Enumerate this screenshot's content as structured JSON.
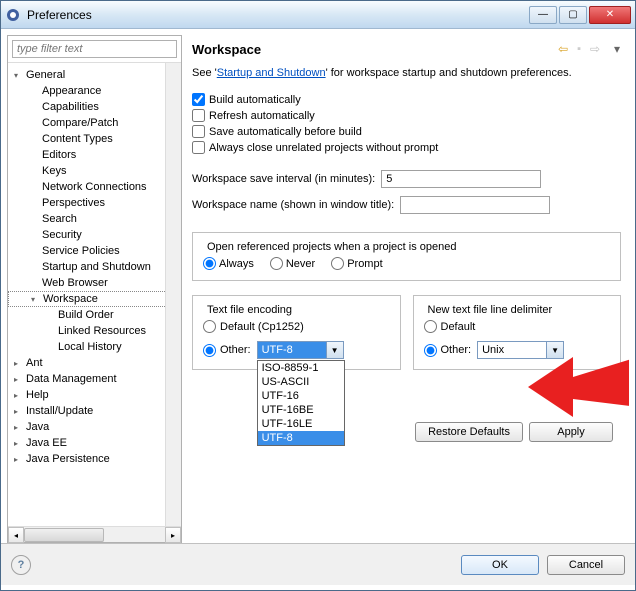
{
  "window": {
    "title": "Preferences"
  },
  "sidebar": {
    "filter_placeholder": "type filter text",
    "items": [
      {
        "label": "General",
        "level": 0,
        "expanded": true
      },
      {
        "label": "Appearance",
        "level": 1
      },
      {
        "label": "Capabilities",
        "level": 1
      },
      {
        "label": "Compare/Patch",
        "level": 1
      },
      {
        "label": "Content Types",
        "level": 1
      },
      {
        "label": "Editors",
        "level": 1
      },
      {
        "label": "Keys",
        "level": 1
      },
      {
        "label": "Network Connections",
        "level": 1
      },
      {
        "label": "Perspectives",
        "level": 1
      },
      {
        "label": "Search",
        "level": 1
      },
      {
        "label": "Security",
        "level": 1
      },
      {
        "label": "Service Policies",
        "level": 1
      },
      {
        "label": "Startup and Shutdown",
        "level": 1
      },
      {
        "label": "Web Browser",
        "level": 1
      },
      {
        "label": "Workspace",
        "level": 1,
        "selected": true,
        "expanded": true
      },
      {
        "label": "Build Order",
        "level": 2
      },
      {
        "label": "Linked Resources",
        "level": 2
      },
      {
        "label": "Local History",
        "level": 2
      },
      {
        "label": "Ant",
        "level": 0
      },
      {
        "label": "Data Management",
        "level": 0
      },
      {
        "label": "Help",
        "level": 0
      },
      {
        "label": "Install/Update",
        "level": 0
      },
      {
        "label": "Java",
        "level": 0
      },
      {
        "label": "Java EE",
        "level": 0
      },
      {
        "label": "Java Persistence",
        "level": 0
      }
    ]
  },
  "main": {
    "title": "Workspace",
    "intro_prefix": "See '",
    "intro_link": "Startup and Shutdown",
    "intro_suffix": "' for workspace startup and shutdown preferences.",
    "checkboxes": {
      "build_auto": "Build automatically",
      "refresh_auto": "Refresh automatically",
      "save_before_build": "Save automatically before build",
      "close_unrelated": "Always close unrelated projects without prompt"
    },
    "checkbox_values": {
      "build_auto": true,
      "refresh_auto": false,
      "save_before_build": false,
      "close_unrelated": false
    },
    "save_interval_label": "Workspace save interval (in minutes):",
    "save_interval_value": "5",
    "workspace_name_label": "Workspace name (shown in window title):",
    "workspace_name_value": "",
    "open_ref_title": "Open referenced projects when a project is opened",
    "open_ref_options": {
      "always": "Always",
      "never": "Never",
      "prompt": "Prompt"
    },
    "open_ref_selected": "always",
    "encoding": {
      "title": "Text file encoding",
      "default_label": "Default (Cp1252)",
      "other_label": "Other:",
      "selected": "other",
      "value": "UTF-8",
      "options": [
        "ISO-8859-1",
        "US-ASCII",
        "UTF-16",
        "UTF-16BE",
        "UTF-16LE",
        "UTF-8"
      ]
    },
    "delimiter": {
      "title": "New text file line delimiter",
      "default_label": "Default",
      "other_label": "Other:",
      "selected": "other",
      "value": "Unix"
    },
    "restore_defaults": "Restore Defaults",
    "apply": "Apply"
  },
  "footer": {
    "ok": "OK",
    "cancel": "Cancel"
  },
  "colors": {
    "accent": "#3a8ee8",
    "arrow": "#e82020"
  }
}
